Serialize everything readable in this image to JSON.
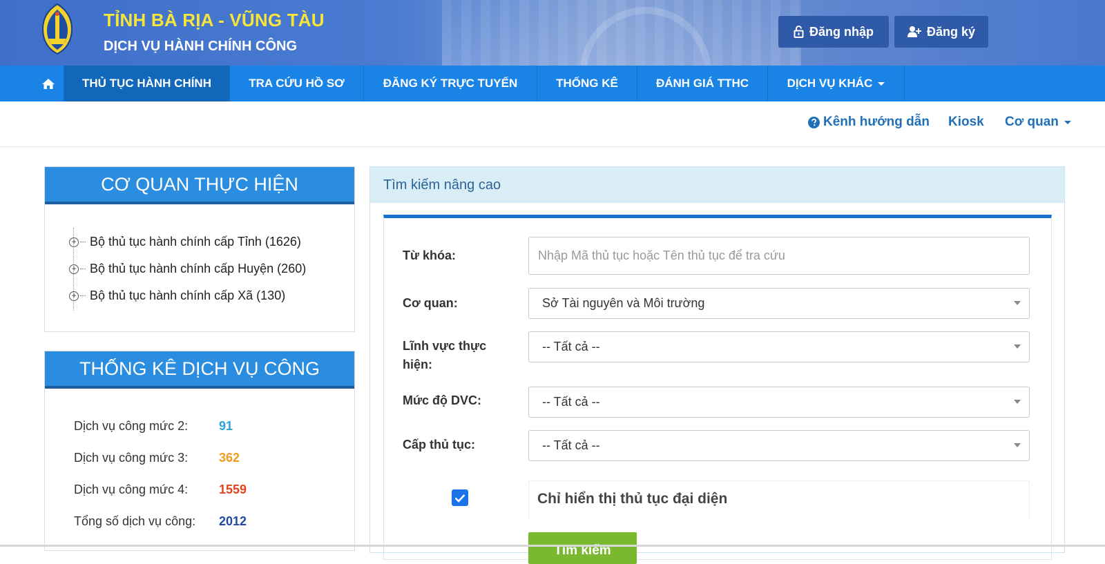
{
  "header": {
    "title": "TỈNH BÀ RỊA - VŨNG TÀU",
    "subtitle": "DỊCH VỤ HÀNH CHÍNH CÔNG",
    "login_label": "Đăng nhập",
    "register_label": "Đăng ký"
  },
  "nav": {
    "items": [
      {
        "label": "THỦ TỤC HÀNH CHÍNH"
      },
      {
        "label": "TRA CỨU HỒ SƠ"
      },
      {
        "label": "ĐĂNG KÝ TRỰC TUYẾN"
      },
      {
        "label": "THỐNG KÊ"
      },
      {
        "label": "ĐÁNH GIÁ TTHC"
      },
      {
        "label": "DỊCH VỤ KHÁC"
      }
    ]
  },
  "subnav": {
    "guide": "Kênh hướng dẫn",
    "kiosk": "Kiosk",
    "agency": "Cơ quan"
  },
  "agencies": {
    "title": "CƠ QUAN THỰC HIỆN",
    "items": [
      {
        "label": "Bộ thủ tục hành chính cấp Tỉnh (1626)"
      },
      {
        "label": "Bộ thủ tục hành chính cấp Huyện (260)"
      },
      {
        "label": "Bộ thủ tục hành chính cấp Xã (130)"
      }
    ]
  },
  "stats": {
    "title": "THỐNG KÊ DỊCH VỤ CÔNG",
    "rows": [
      {
        "label": "Dịch vụ công mức 2:",
        "value": "91",
        "color": "#2aa3d8"
      },
      {
        "label": "Dịch vụ công mức 3:",
        "value": "362",
        "color": "#f39a1f"
      },
      {
        "label": "Dịch vụ công mức 4:",
        "value": "1559",
        "color": "#e2441b"
      },
      {
        "label": "Tổng số dịch vụ công:",
        "value": "2012",
        "color": "#1f4aa0"
      }
    ]
  },
  "search": {
    "title": "Tìm kiếm nâng cao",
    "keyword_label": "Từ khóa:",
    "keyword_placeholder": "Nhập Mã thủ tục hoặc Tên thủ tục để tra cứu",
    "agency_label": "Cơ quan:",
    "agency_value": "Sở Tài nguyên và Môi trường",
    "field_label": "Lĩnh vực thực hiện:",
    "field_value": "-- Tất cả --",
    "level_label": "Mức độ DVC:",
    "level_value": "-- Tất cả --",
    "tier_label": "Cấp thủ tục:",
    "tier_value": "-- Tất cả --",
    "representative_label": "Chỉ hiển thị thủ tục đại diện",
    "representative_checked": true,
    "button_label": "Tìm kiếm"
  },
  "colors": {
    "nav": "#1a83e6",
    "nav_active": "#1168bb",
    "panel_head": "#2b8ddf",
    "brand_yellow": "#f6e53b",
    "search_button": "#7ab82f"
  }
}
